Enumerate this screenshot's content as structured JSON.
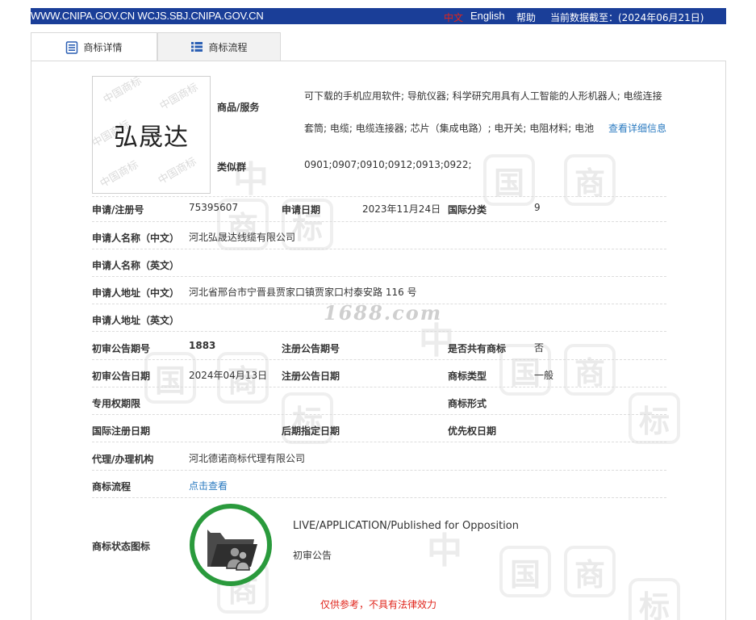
{
  "topbar": {
    "site_links": "WWW.CNIPA.GOV.CN WCJS.SBJ.CNIPA.GOV.CN",
    "lang_cn": "中文",
    "lang_en": "English",
    "help": "帮助",
    "as_of": "当前数据截至：(2024年06月21日)"
  },
  "tabs": [
    {
      "label": "商标详情",
      "icon": "document-list-icon"
    },
    {
      "label": "商标流程",
      "icon": "list-icon"
    }
  ],
  "mark": {
    "text": "弘晟达",
    "watermark": "中国商标"
  },
  "goods": {
    "label": "商品/服务",
    "value": "可下载的手机应用软件; 导航仪器; 科学研究用具有人工智能的人形机器人; 电缆连接套筒; 电缆; 电缆连接器; 芯片（集成电路）; 电开关; 电阻材料; 电池",
    "more_link": "查看详细信息"
  },
  "similar": {
    "label": "类似群",
    "value": "0901;0907;0910;0912;0913;0922;"
  },
  "rows": {
    "reg_no_label": "申请/注册号",
    "reg_no": "75395607",
    "apply_date_label": "申请日期",
    "apply_date": "2023年11月24日",
    "intl_class_label": "国际分类",
    "intl_class": "9",
    "applicant_cn_label": "申请人名称（中文）",
    "applicant_cn": "河北弘晟达线缆有限公司",
    "applicant_en_label": "申请人名称（英文）",
    "address_cn_label": "申请人地址（中文）",
    "address_cn": "河北省邢台市宁晋县贾家口镇贾家口村泰安路 116 号",
    "address_en_label": "申请人地址（英文）",
    "prelim_no_label": "初审公告期号",
    "prelim_no": "1883",
    "reg_pub_no_label": "注册公告期号",
    "shared_label": "是否共有商标",
    "shared": "否",
    "prelim_date_label": "初审公告日期",
    "prelim_date": "2024年04月13日",
    "reg_pub_date_label": "注册公告日期",
    "mark_type_label": "商标类型",
    "mark_type": "一般",
    "exclusive_period_label": "专用权期限",
    "mark_form_label": "商标形式",
    "intl_reg_date_label": "国际注册日期",
    "later_designation_label": "后期指定日期",
    "priority_date_label": "优先权日期",
    "agent_label": "代理/办理机构",
    "agent": "河北德诺商标代理有限公司",
    "process_label": "商标流程",
    "process_link": "点击查看",
    "status_icon_label": "商标状态图标",
    "status_en": "LIVE/APPLICATION/Published for Opposition",
    "status_cn": "初审公告"
  },
  "disclaimer": "仅供参考，不具有法律效力",
  "site_watermark": "1688.com",
  "colors": {
    "topbar": "#1a3e98",
    "status_ring": "#2a9a3c",
    "link": "#2a7ac0",
    "warning": "#e0241b"
  }
}
